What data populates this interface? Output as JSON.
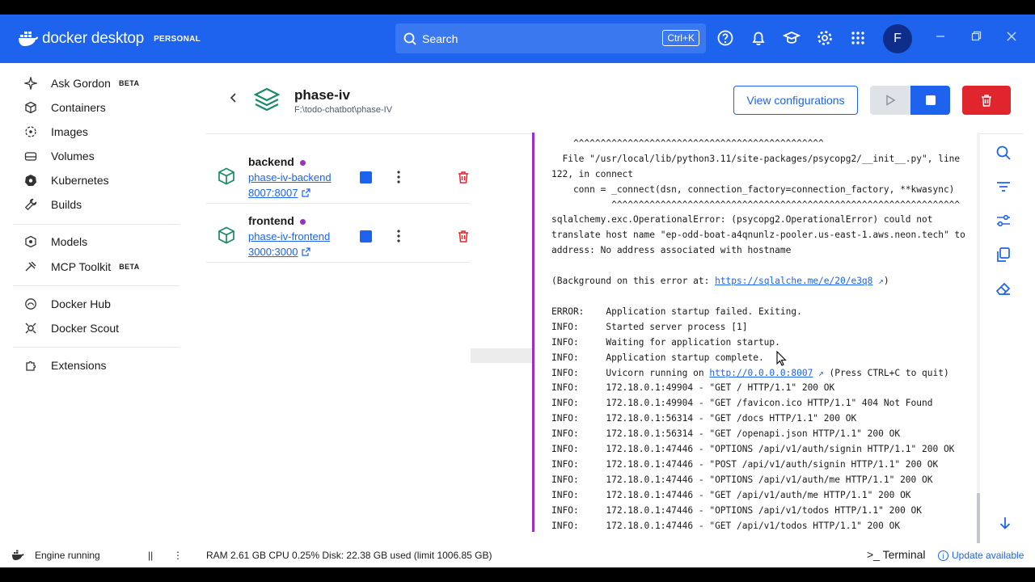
{
  "header": {
    "brand_name": "docker desktop",
    "plan": "PERSONAL",
    "search_placeholder": "Search",
    "search_shortcut": "Ctrl+K",
    "avatar_initial": "F",
    "accent_color": "#1d63ed"
  },
  "sidebar": {
    "items": [
      {
        "label": "Ask Gordon",
        "badge": "BETA",
        "icon": "gordon-icon"
      },
      {
        "label": "Containers",
        "icon": "container-icon"
      },
      {
        "label": "Images",
        "icon": "image-icon"
      },
      {
        "label": "Volumes",
        "icon": "volume-icon"
      },
      {
        "label": "Kubernetes",
        "icon": "kubernetes-icon"
      },
      {
        "label": "Builds",
        "icon": "wrench-icon"
      },
      {
        "label": "Models",
        "icon": "model-icon"
      },
      {
        "label": "MCP Toolkit",
        "badge": "BETA",
        "icon": "mcp-icon"
      },
      {
        "label": "Docker Hub",
        "icon": "hub-icon"
      },
      {
        "label": "Docker Scout",
        "icon": "scout-icon"
      },
      {
        "label": "Extensions",
        "icon": "puzzle-icon"
      }
    ]
  },
  "project": {
    "title": "phase-iv",
    "path": "F:\\todo-chatbot\\phase-IV",
    "view_config_label": "View configurations"
  },
  "services": [
    {
      "name": "backend",
      "link": "phase-iv-backend",
      "port": "8007:8007",
      "status_color": "#9b2fc4"
    },
    {
      "name": "frontend",
      "link": "phase-iv-frontend",
      "port": "3000:3000",
      "status_color": "#9b2fc4"
    }
  ],
  "logs": {
    "lines": [
      "    ^^^^^^^^^^^^^^^^^^^^^^^^^^^^^^^^^^^^^^^^^^^^^^",
      "  File \"/usr/local/lib/python3.11/site-packages/psycopg2/__init__.py\", line",
      "122, in connect",
      "    conn = _connect(dsn, connection_factory=connection_factory, **kwasync)",
      "           ^^^^^^^^^^^^^^^^^^^^^^^^^^^^^^^^^^^^^^^^^^^^^^^^^^^^^^^^^^^^^^^^",
      "sqlalchemy.exc.OperationalError: (psycopg2.OperationalError) could not",
      "translate host name \"ep-odd-boat-a4qnunlz-pooler.us-east-1.aws.neon.tech\" to",
      "address: No address associated with hostname",
      "",
      "(Background on this error at: ",
      "",
      "ERROR:    Application startup failed. Exiting.",
      "INFO:     Started server process [1]",
      "INFO:     Waiting for application startup.",
      "INFO:     Application startup complete.",
      "INFO:     Uvicorn running on ",
      "INFO:     172.18.0.1:49904 - \"GET / HTTP/1.1\" 200 OK",
      "INFO:     172.18.0.1:49904 - \"GET /favicon.ico HTTP/1.1\" 404 Not Found",
      "INFO:     172.18.0.1:56314 - \"GET /docs HTTP/1.1\" 200 OK",
      "INFO:     172.18.0.1:56314 - \"GET /openapi.json HTTP/1.1\" 200 OK",
      "INFO:     172.18.0.1:47446 - \"OPTIONS /api/v1/auth/signin HTTP/1.1\" 200 OK",
      "INFO:     172.18.0.1:47446 - \"POST /api/v1/auth/signin HTTP/1.1\" 200 OK",
      "INFO:     172.18.0.1:47446 - \"OPTIONS /api/v1/auth/me HTTP/1.1\" 200 OK",
      "INFO:     172.18.0.1:47446 - \"GET /api/v1/auth/me HTTP/1.1\" 200 OK",
      "INFO:     172.18.0.1:47446 - \"OPTIONS /api/v1/todos HTTP/1.1\" 200 OK",
      "INFO:     172.18.0.1:47446 - \"GET /api/v1/todos HTTP/1.1\" 200 OK"
    ],
    "links": {
      "9": {
        "text": "https://sqlalche.me/e/20/e3q8",
        "suffix": ")"
      },
      "15": {
        "text": "http://0.0.0.0:8007",
        "suffix": " (Press CTRL+C to quit)"
      }
    }
  },
  "footer": {
    "engine_status": "Engine running",
    "pause": "||",
    "more": "⋮",
    "stats": "RAM 2.61 GB  CPU 0.25%    Disk: 22.38 GB used (limit 1006.85 GB)",
    "terminal_label": "Terminal",
    "terminal_prefix": ">_",
    "update_label": "Update available"
  }
}
